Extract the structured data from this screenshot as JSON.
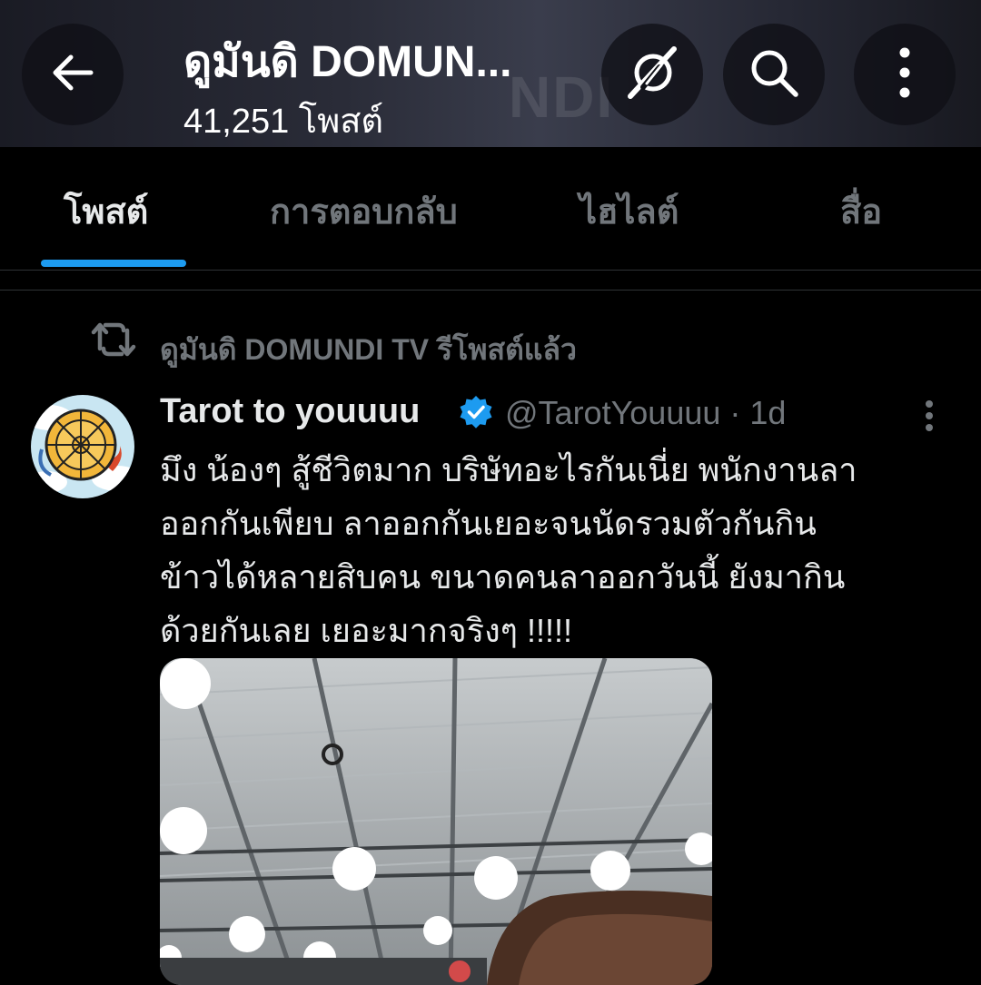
{
  "header": {
    "title": "ดูมันดิ DOMUN...",
    "post_count": "41,251 โพสต์",
    "background_ghost_text": "NDI"
  },
  "tabs": [
    {
      "label": "โพสต์",
      "active": true
    },
    {
      "label": "การตอบกลับ",
      "active": false
    },
    {
      "label": "ไฮไลต์",
      "active": false
    },
    {
      "label": "สื่อ",
      "active": false
    }
  ],
  "post": {
    "repost_label": "ดูมันดิ DOMUNDI TV รีโพสต์แล้ว",
    "author": {
      "name": "Tarot to youuuu",
      "verified": true,
      "handle_time": "@TarotYouuuu · 1d"
    },
    "text_lines": [
      "มึง น้องๆ สู้ชีวิตมาก บริษัทอะไรกันเนี่ย พนักงานลา",
      "ออกกันเพียบ  ลาออกกันเยอะจนนัดรวมตัวกันกิน",
      "ข้าวได้หลายสิบคน ขนาดคนลาออกวันนี้ ยังมากิน",
      "ด้วยกันเลย เยอะมากจริงๆ !!!!!"
    ]
  },
  "icons": {
    "back": "arrow-left-icon",
    "grok": "grok-icon",
    "search": "search-icon",
    "more": "more-vertical-icon",
    "repost": "repost-icon",
    "verified": "verified-badge-icon"
  },
  "colors": {
    "accent": "#1d9bf0",
    "text_primary": "#e7e9ea",
    "text_secondary": "#71767b",
    "background": "#000000",
    "divider": "#2f3336"
  }
}
